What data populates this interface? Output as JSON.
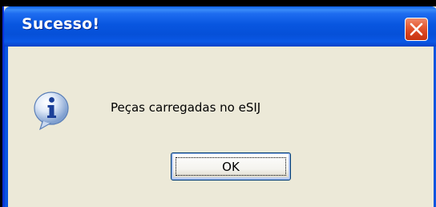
{
  "dialog": {
    "title": "Sucesso!",
    "message": "Peças carregadas no eSIJ",
    "icon": "info-icon",
    "ok_label": "OK",
    "close_icon": "close-icon"
  },
  "colors": {
    "titlebar": "#0856e0",
    "body": "#ece9d8",
    "close": "#d6401c",
    "button_border": "#003c74"
  }
}
